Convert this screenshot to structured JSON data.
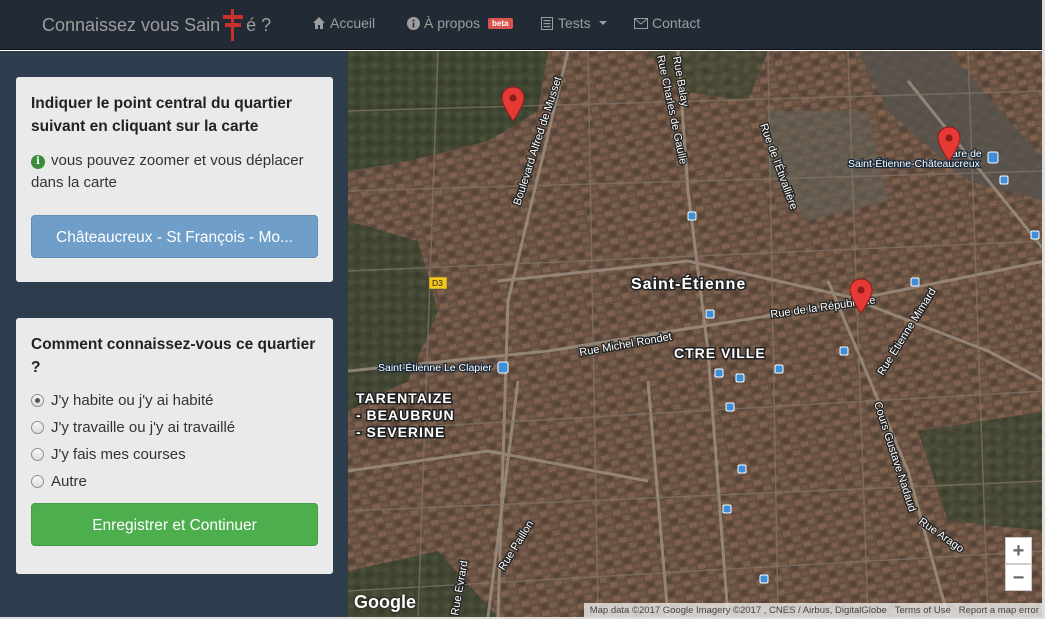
{
  "navbar": {
    "brand_before": "Connaissez vous Sain",
    "brand_after": "é ?",
    "items": [
      {
        "label": "Accueil",
        "icon": "home-icon"
      },
      {
        "label": "À propos",
        "icon": "info-sign-icon",
        "badge": "beta"
      },
      {
        "label": "Tests",
        "icon": "list-icon"
      },
      {
        "label": "Contact",
        "icon": "envelope-icon"
      }
    ]
  },
  "panel1": {
    "heading": "Indiquer le point central du quartier suivant en cliquant sur la carte",
    "hint": "vous pouvez zoomer et vous déplacer dans la carte",
    "quartier_button": "Châteaucreux - St François - Mo..."
  },
  "panel2": {
    "heading": "Comment connaissez-vous ce quartier ?",
    "options": [
      {
        "label": "J'y habite ou j'y ai habité",
        "checked": true
      },
      {
        "label": "J'y travaille ou j'y ai travaillé",
        "checked": false
      },
      {
        "label": "J'y fais mes courses",
        "checked": false
      },
      {
        "label": "Autre",
        "checked": false
      }
    ],
    "submit_button": "Enregistrer et Continuer"
  },
  "map": {
    "labels": {
      "city": "Saint-Étienne",
      "centre": "CTRE VILLE",
      "district_1": "TARENTAIZE",
      "district_2": "- BEAUBRUN",
      "district_3": "- SEVERINE",
      "boulevard": "Boulevard Alfred de Musset",
      "rue_charles": "Rue Charles de Gaulle",
      "rue_balay": "Rue Balay",
      "rue_etivallière": "Rue de l'Étivallière",
      "rue_republique": "Rue de la République",
      "rue_michel": "Rue Michel Rondet",
      "rue_mimard": "Rue Étienne Mimard",
      "cours_fauriel": "Cours Gustave Nadaud",
      "rue_arago": "Rue Arago",
      "rue_paillon": "Rue Paillon",
      "rue_evrard": "Rue Evrard",
      "station_clapier": "Saint-Étienne Le Clapier",
      "station_chateaucreux_1": "are de",
      "station_chateaucreux_2": "Saint-Étienne-Châteaucreux",
      "road_d3": "D3"
    },
    "zoom_in": "+",
    "zoom_out": "−",
    "google_logo": "Google",
    "attribution": "Map data ©2017 Google Imagery ©2017 , CNES / Airbus, DigitalGlobe",
    "terms": "Terms of Use",
    "report": "Report a map error",
    "marker_color": "#e53935"
  }
}
